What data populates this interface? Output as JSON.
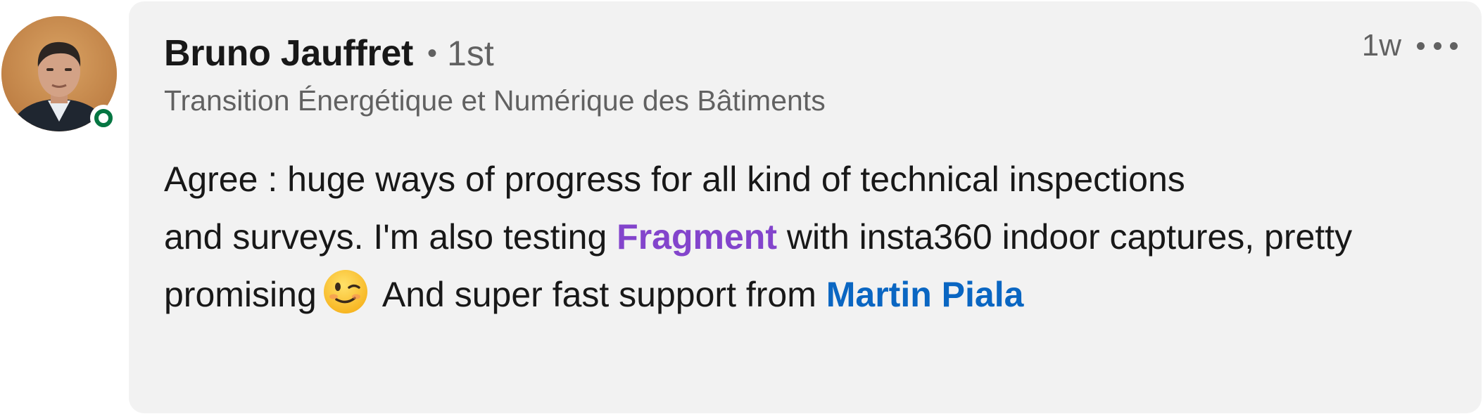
{
  "comment": {
    "author": {
      "name": "Bruno Jauffret",
      "separator": "•",
      "degree": "1st",
      "headline": "Transition Énergétique et Numérique des Bâtiments",
      "online": true
    },
    "timestamp": "1w",
    "more_icon": "ellipsis-horizontal-icon",
    "body": {
      "line1": "Agree : huge ways of progress for all kind of technical inspections",
      "part2": "and surveys. I'm also testing ",
      "mention_company": "Fragment",
      "part3": " with insta360 indoor captures, pretty promising",
      "emoji": "winking-face-icon",
      "part4": " And super fast support from ",
      "mention_person": "Martin Piala"
    }
  },
  "colors": {
    "bubble_bg": "#f2f2f2",
    "company_mention": "#8344cc",
    "person_mention": "#0a66c2",
    "presence": "#057642"
  }
}
